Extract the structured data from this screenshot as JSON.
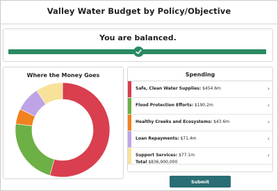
{
  "header": {
    "title": "Valley Water Budget by Policy/Objective"
  },
  "balance": {
    "status_text": "You are balanced.",
    "fill_fraction": 1.0,
    "bar_color": "#2a8a62"
  },
  "chart_panel": {
    "title": "Where the Money Goes"
  },
  "spending": {
    "title": "Spending",
    "items": [
      {
        "name": "Safe, Clean Water Supplies:",
        "amount": "$454.6m",
        "value": 454.6,
        "color": "#d93f4e"
      },
      {
        "name": "Flood Protection Efforts:",
        "amount": "$190.2m",
        "value": 190.2,
        "color": "#6db046"
      },
      {
        "name": "Healthy Creeks and Ecosystems:",
        "amount": "$43.6m",
        "value": 43.6,
        "color": "#f0821f"
      },
      {
        "name": "Loan Repayments:",
        "amount": "$71.4m",
        "value": 71.4,
        "color": "#bea4e6"
      },
      {
        "name": "Support Services:",
        "amount": "$77.1m",
        "value": 77.1,
        "color": "#f8e29a"
      }
    ],
    "total_label": "Total",
    "total_value": "$836,900,000"
  },
  "footer": {
    "submit_label": "Submit"
  },
  "chart_data": {
    "type": "pie",
    "title": "Where the Money Goes",
    "categories": [
      "Safe, Clean Water Supplies",
      "Flood Protection Efforts",
      "Healthy Creeks and Ecosystems",
      "Loan Repayments",
      "Support Services"
    ],
    "values": [
      454.6,
      190.2,
      43.6,
      71.4,
      77.1
    ],
    "colors": [
      "#d93f4e",
      "#6db046",
      "#f0821f",
      "#bea4e6",
      "#f8e29a"
    ],
    "donut": true
  }
}
